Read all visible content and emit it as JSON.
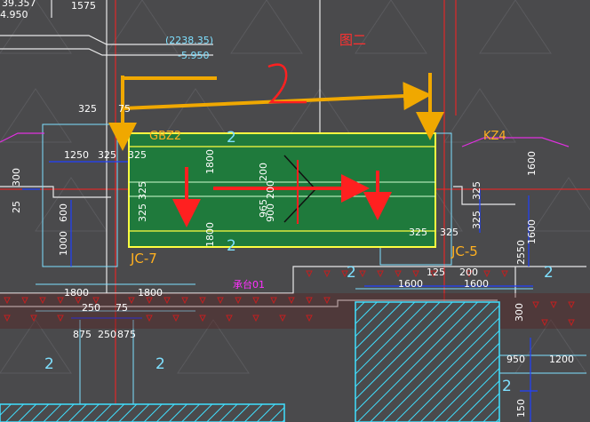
{
  "colors": {
    "background": "#4a4a4c",
    "dim_white": "#ffffff",
    "dim_cyan": "#7fe0ff",
    "green_fill": "#1f7a3c",
    "yellow_outline": "#ffff40",
    "orange_label": "#ffb020",
    "red_line": "#ff2020",
    "arrow_orange": "#f0a800",
    "hatch_cyan": "#40e0ff"
  },
  "labels": {
    "top_elev1": "39.357",
    "top_elev2": "4.950",
    "dim_1575": "1575",
    "elev_paren": "(2238.35)",
    "elev_val": "-5.950",
    "figure_label": "图二",
    "dim_325_top": "325",
    "dim_75": "75",
    "gbz2": "GBZ2",
    "kz4": "KZ4",
    "grid_2a": "2",
    "grid_2b": "2",
    "grid_2c": "2",
    "grid_2d": "2",
    "grid_2e": "2",
    "grid_2f": "2",
    "dim_1250": "1250",
    "dim_325a": "325",
    "dim_325b": "325",
    "dim_300": "300",
    "dim_25": "25",
    "dim_600": "600",
    "dim_1000": "1000",
    "dim_1800v_top": "1800",
    "dim_1800v_bot": "1800",
    "dim_325v_a": "325",
    "dim_325v_b": "325",
    "dim_200": "200",
    "dim_200b": "200",
    "dim_965": "965",
    "dim_900": "900",
    "dim_325c": "325",
    "dim_325d": "325",
    "dim_1600v": "1600",
    "dim_325v_c": "325",
    "dim_325v_d": "325",
    "dim_1600v_b": "1600",
    "dim_2550": "2550",
    "jc7": "JC-7",
    "jc5": "JC-5",
    "magenta_text": "承台01",
    "dim_125": "125",
    "dim_200c": "200",
    "dim_1600a": "1600",
    "dim_1600b": "1600",
    "dim_1800a": "1800",
    "dim_1800b": "1800",
    "dim_250": "250",
    "dim_75b": "75",
    "dim_875a": "875",
    "dim_250b": "250",
    "dim_875b": "875",
    "dim_300b": "300",
    "dim_950": "950",
    "dim_1200": "1200",
    "dim_150": "150",
    "annotation_2": "2"
  }
}
